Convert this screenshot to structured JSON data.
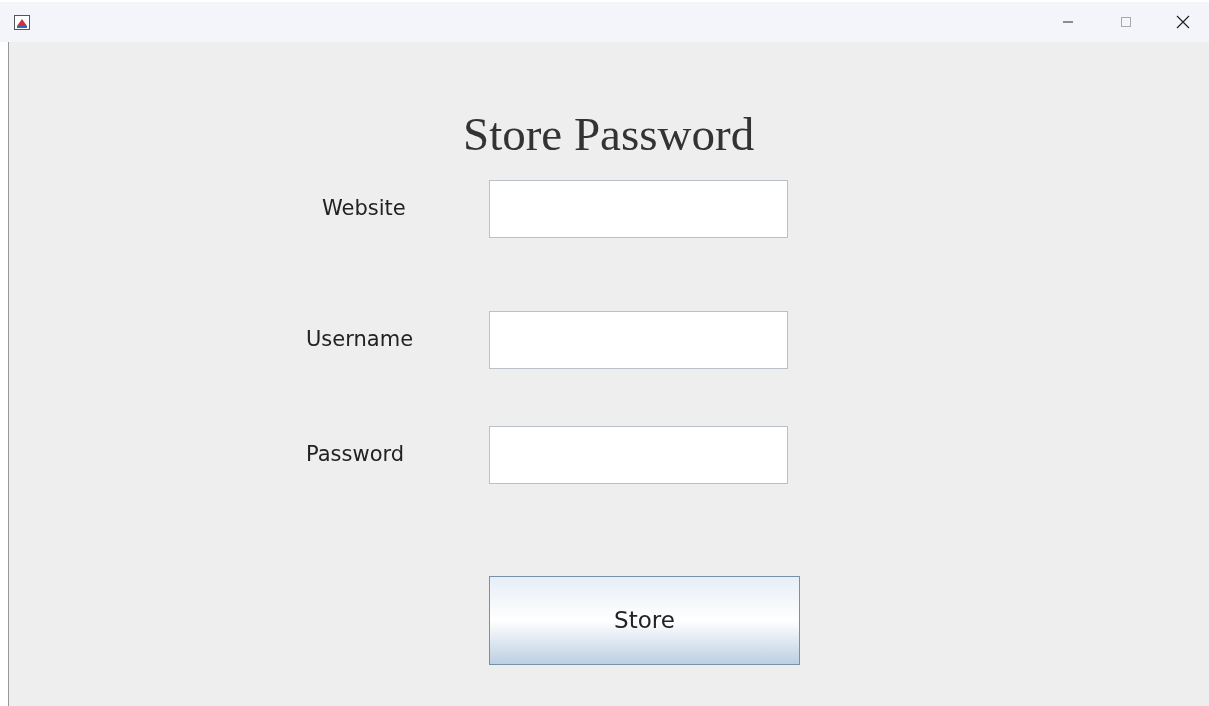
{
  "heading": "Store Password",
  "fields": [
    {
      "label": "Website"
    },
    {
      "label": "Username"
    },
    {
      "label": "Password"
    }
  ],
  "button": "Store"
}
